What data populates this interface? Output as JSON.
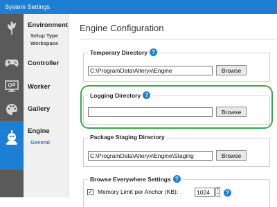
{
  "window": {
    "title": "System Settings"
  },
  "sidebar": {
    "items": [
      {
        "label": "Environment",
        "subs": [
          "Setup Type",
          "Workspace"
        ]
      },
      {
        "label": "Controller"
      },
      {
        "label": "Worker"
      },
      {
        "label": "Gallery"
      },
      {
        "label": "Engine",
        "subs": [
          "General"
        ]
      }
    ],
    "icons": [
      "leaf-icon",
      "gamepad-icon",
      "monitor-gear-icon",
      "palette-icon",
      "engine-robot-icon"
    ]
  },
  "main": {
    "title": "Engine Configuration",
    "sections": {
      "temp_dir": {
        "label": "Temporary Directory",
        "value": "C:\\ProgramData\\Alteryx\\Engine",
        "browse": "Browse"
      },
      "log_dir": {
        "label": "Logging Directory",
        "value": "",
        "browse": "Browse"
      },
      "staging_dir": {
        "label": "Package Staging Directory",
        "value": "C:\\ProgramData\\Alteryx\\Engine\\Staging",
        "browse": "Browse"
      },
      "browse_everywhere": {
        "label": "Browse Everywhere Settings",
        "memory_label": "Memory Limit per Anchor (KB):",
        "memory_value": "1024",
        "checked": true
      }
    },
    "help_glyph": "?",
    "check_glyph": "✓"
  },
  "colors": {
    "accent": "#1c7fd4",
    "sidebar_dark": "#5a5a5a",
    "highlight": "#35a84a"
  }
}
